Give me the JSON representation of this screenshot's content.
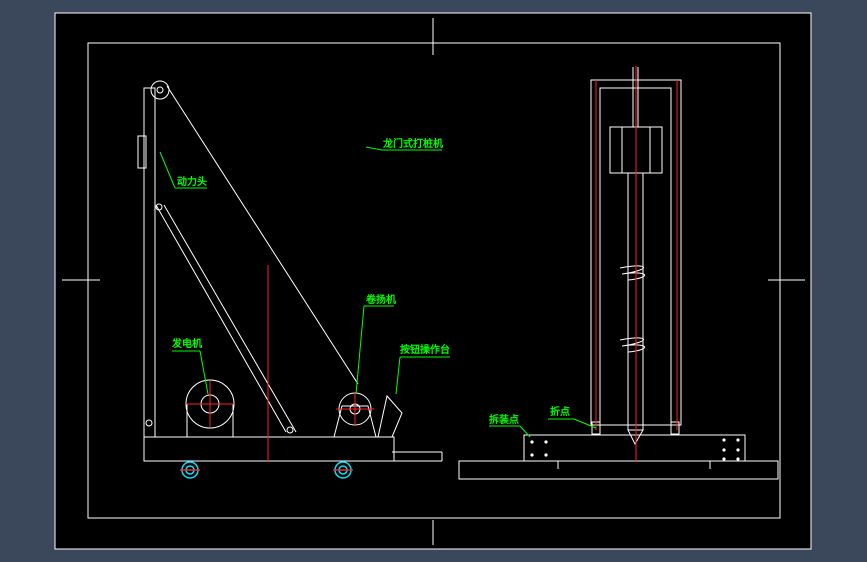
{
  "labels": {
    "title": "龙门式打桩机",
    "power_head": "动力头",
    "winch": "卷扬机",
    "motor": "发电机",
    "console": "按钮操作台",
    "dismount_point": "拆装点",
    "pivot_point": "折点"
  },
  "colors": {
    "background": "#3b475a",
    "canvas": "#000000",
    "line": "#ffffff",
    "center_line": "#ff2020",
    "label": "#00ff00",
    "wheel": "#00e5ff"
  },
  "icons": {
    "wheel": "wheel-icon"
  }
}
